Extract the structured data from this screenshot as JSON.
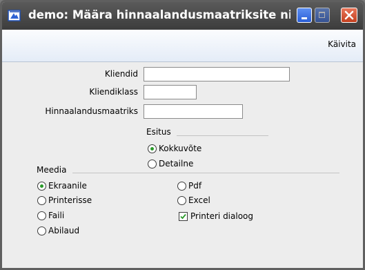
{
  "window": {
    "title": "demo: Määra hinnaalandusmaatriksite nime…"
  },
  "toolbar": {
    "run_label": "Käivita"
  },
  "fields": [
    {
      "label": "Kliendid",
      "value": ""
    },
    {
      "label": "Kliendiklass",
      "value": ""
    },
    {
      "label": "Hinnaalandusmaatriks",
      "value": ""
    }
  ],
  "esitus": {
    "title": "Esitus",
    "options": [
      {
        "label": "Kokkuvõte",
        "selected": true
      },
      {
        "label": "Detailne",
        "selected": false
      }
    ]
  },
  "meedia": {
    "title": "Meedia",
    "options_left": [
      {
        "label": "Ekraanile",
        "selected": true
      },
      {
        "label": "Printerisse",
        "selected": false
      },
      {
        "label": "Faili",
        "selected": false
      },
      {
        "label": "Abilaud",
        "selected": false
      }
    ],
    "options_right": [
      {
        "label": "Pdf",
        "selected": false
      },
      {
        "label": "Excel",
        "selected": false
      }
    ],
    "printer_dialog": {
      "label": "Printeri dialoog",
      "checked": true
    }
  }
}
